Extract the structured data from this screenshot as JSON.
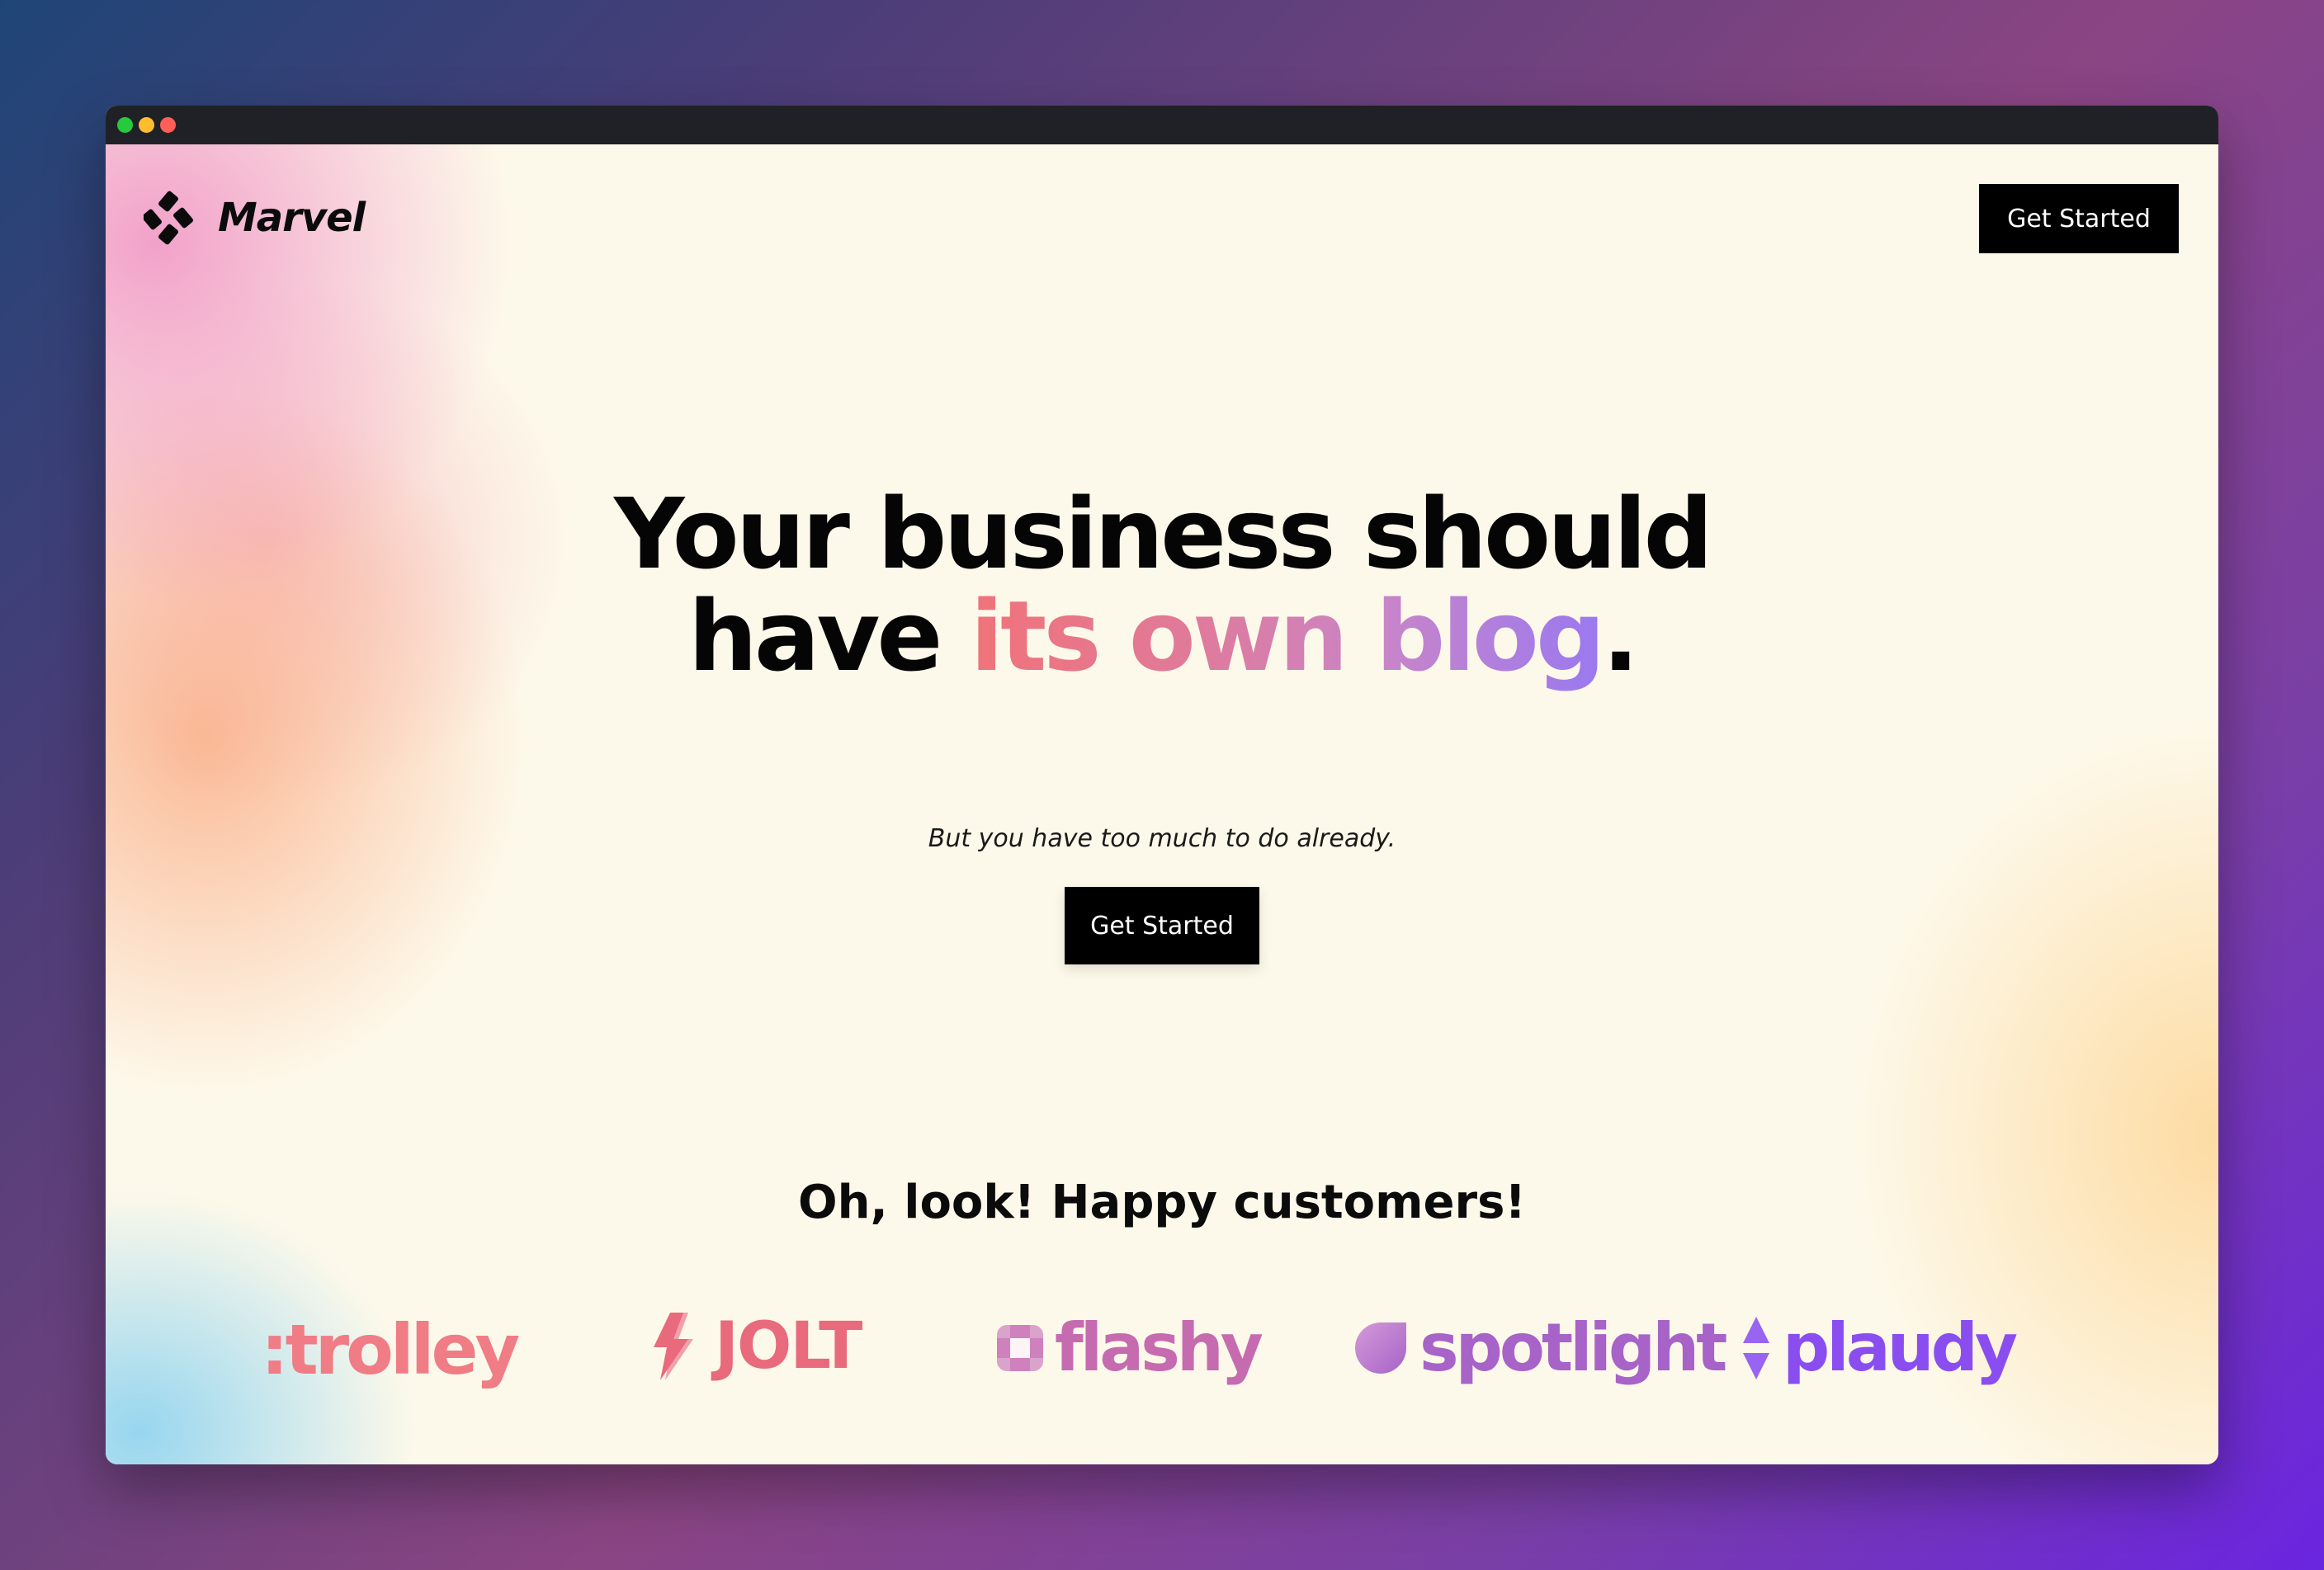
{
  "window": {
    "controls": [
      "green-dot",
      "yellow-dot",
      "red-dot"
    ]
  },
  "nav": {
    "logo_text": "Marvel",
    "cta_label": "Get Started"
  },
  "hero": {
    "title_line1": "Your business should",
    "title_have": "have",
    "title_highlight": "its own blog",
    "title_period": ".",
    "subtitle": "But you have too much to do already.",
    "cta_label": "Get Started"
  },
  "customers": {
    "heading": "Oh, look! Happy customers!",
    "brands": [
      {
        "name": ":trolley",
        "color": "#f07c86",
        "icon": "colon-icon"
      },
      {
        "name": "JOLT",
        "color": "#e86a7c",
        "icon": "lightning-icon"
      },
      {
        "name": "flashy",
        "color": "#c66bb0",
        "icon": "square-grid-icon"
      },
      {
        "name": "spotlight",
        "color": "#a763c8",
        "icon": "leaf-icon"
      },
      {
        "name": "plaudy",
        "color": "#8a4ef0",
        "icon": "up-down-arrows-icon"
      }
    ]
  },
  "colors": {
    "gradient_text": [
      "#f07379",
      "#e07a9a",
      "#c985c8",
      "#9a79f0"
    ],
    "button_bg": "#000000",
    "page_bg": "#fdf9ea"
  }
}
